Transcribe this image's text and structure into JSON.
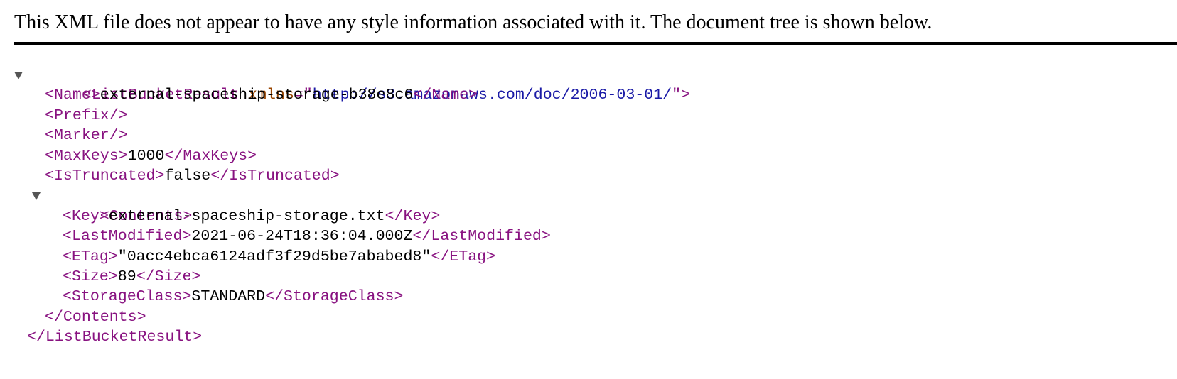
{
  "header": {
    "message": "This XML file does not appear to have any style information associated with it. The document tree is shown below."
  },
  "tree": {
    "root_open": "<ListBucketResult",
    "root_attr_name": "xmlns",
    "root_attr_eq": "=\"",
    "root_attr_value": "http://s3.amazonaws.com/doc/2006-03-01/",
    "root_attr_close": "\">",
    "name_open": "<Name>",
    "name_value": "external-spaceship-storage-b38e8c6",
    "name_close": "</Name>",
    "prefix": "<Prefix/>",
    "marker": "<Marker/>",
    "maxkeys_open": "<MaxKeys>",
    "maxkeys_value": "1000",
    "maxkeys_close": "</MaxKeys>",
    "istruncated_open": "<IsTruncated>",
    "istruncated_value": "false",
    "istruncated_close": "</IsTruncated>",
    "contents_open": "<Contents>",
    "key_open": "<Key>",
    "key_value": "external-spaceship-storage.txt",
    "key_close": "</Key>",
    "lastmodified_open": "<LastModified>",
    "lastmodified_value": "2021-06-24T18:36:04.000Z",
    "lastmodified_close": "</LastModified>",
    "etag_open": "<ETag>",
    "etag_value": "\"0acc4ebca6124adf3f29d5be7ababed8\"",
    "etag_close": "</ETag>",
    "size_open": "<Size>",
    "size_value": "89",
    "size_close": "</Size>",
    "storageclass_open": "<StorageClass>",
    "storageclass_value": "STANDARD",
    "storageclass_close": "</StorageClass>",
    "contents_close": "</Contents>",
    "root_close": "</ListBucketResult>"
  },
  "colors": {
    "tag": "#881280",
    "attribute_name": "#994500",
    "attribute_value": "#1a1aa6",
    "text": "#000000"
  },
  "icons": {
    "toggle": "disclosure-triangle-down-icon"
  }
}
